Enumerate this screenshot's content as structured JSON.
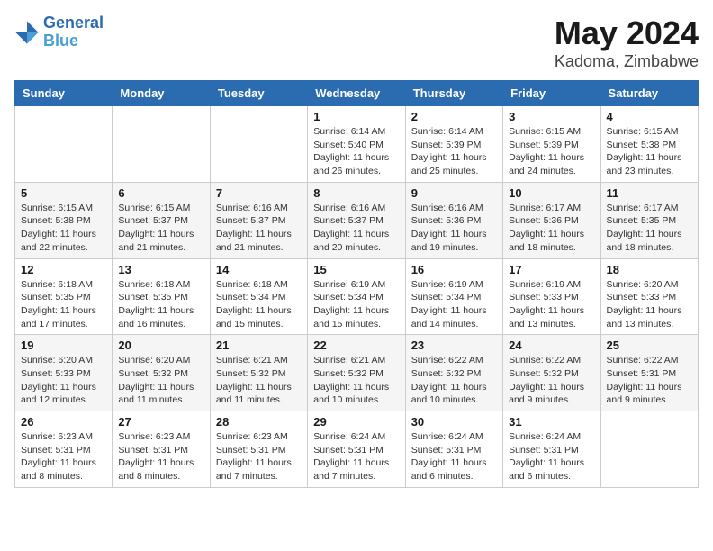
{
  "header": {
    "logo_general": "General",
    "logo_blue": "Blue",
    "month_title": "May 2024",
    "location": "Kadoma, Zimbabwe"
  },
  "weekdays": [
    "Sunday",
    "Monday",
    "Tuesday",
    "Wednesday",
    "Thursday",
    "Friday",
    "Saturday"
  ],
  "weeks": [
    [
      {
        "day": "",
        "info": ""
      },
      {
        "day": "",
        "info": ""
      },
      {
        "day": "",
        "info": ""
      },
      {
        "day": "1",
        "info": "Sunrise: 6:14 AM\nSunset: 5:40 PM\nDaylight: 11 hours\nand 26 minutes."
      },
      {
        "day": "2",
        "info": "Sunrise: 6:14 AM\nSunset: 5:39 PM\nDaylight: 11 hours\nand 25 minutes."
      },
      {
        "day": "3",
        "info": "Sunrise: 6:15 AM\nSunset: 5:39 PM\nDaylight: 11 hours\nand 24 minutes."
      },
      {
        "day": "4",
        "info": "Sunrise: 6:15 AM\nSunset: 5:38 PM\nDaylight: 11 hours\nand 23 minutes."
      }
    ],
    [
      {
        "day": "5",
        "info": "Sunrise: 6:15 AM\nSunset: 5:38 PM\nDaylight: 11 hours\nand 22 minutes."
      },
      {
        "day": "6",
        "info": "Sunrise: 6:15 AM\nSunset: 5:37 PM\nDaylight: 11 hours\nand 21 minutes."
      },
      {
        "day": "7",
        "info": "Sunrise: 6:16 AM\nSunset: 5:37 PM\nDaylight: 11 hours\nand 21 minutes."
      },
      {
        "day": "8",
        "info": "Sunrise: 6:16 AM\nSunset: 5:37 PM\nDaylight: 11 hours\nand 20 minutes."
      },
      {
        "day": "9",
        "info": "Sunrise: 6:16 AM\nSunset: 5:36 PM\nDaylight: 11 hours\nand 19 minutes."
      },
      {
        "day": "10",
        "info": "Sunrise: 6:17 AM\nSunset: 5:36 PM\nDaylight: 11 hours\nand 18 minutes."
      },
      {
        "day": "11",
        "info": "Sunrise: 6:17 AM\nSunset: 5:35 PM\nDaylight: 11 hours\nand 18 minutes."
      }
    ],
    [
      {
        "day": "12",
        "info": "Sunrise: 6:18 AM\nSunset: 5:35 PM\nDaylight: 11 hours\nand 17 minutes."
      },
      {
        "day": "13",
        "info": "Sunrise: 6:18 AM\nSunset: 5:35 PM\nDaylight: 11 hours\nand 16 minutes."
      },
      {
        "day": "14",
        "info": "Sunrise: 6:18 AM\nSunset: 5:34 PM\nDaylight: 11 hours\nand 15 minutes."
      },
      {
        "day": "15",
        "info": "Sunrise: 6:19 AM\nSunset: 5:34 PM\nDaylight: 11 hours\nand 15 minutes."
      },
      {
        "day": "16",
        "info": "Sunrise: 6:19 AM\nSunset: 5:34 PM\nDaylight: 11 hours\nand 14 minutes."
      },
      {
        "day": "17",
        "info": "Sunrise: 6:19 AM\nSunset: 5:33 PM\nDaylight: 11 hours\nand 13 minutes."
      },
      {
        "day": "18",
        "info": "Sunrise: 6:20 AM\nSunset: 5:33 PM\nDaylight: 11 hours\nand 13 minutes."
      }
    ],
    [
      {
        "day": "19",
        "info": "Sunrise: 6:20 AM\nSunset: 5:33 PM\nDaylight: 11 hours\nand 12 minutes."
      },
      {
        "day": "20",
        "info": "Sunrise: 6:20 AM\nSunset: 5:32 PM\nDaylight: 11 hours\nand 11 minutes."
      },
      {
        "day": "21",
        "info": "Sunrise: 6:21 AM\nSunset: 5:32 PM\nDaylight: 11 hours\nand 11 minutes."
      },
      {
        "day": "22",
        "info": "Sunrise: 6:21 AM\nSunset: 5:32 PM\nDaylight: 11 hours\nand 10 minutes."
      },
      {
        "day": "23",
        "info": "Sunrise: 6:22 AM\nSunset: 5:32 PM\nDaylight: 11 hours\nand 10 minutes."
      },
      {
        "day": "24",
        "info": "Sunrise: 6:22 AM\nSunset: 5:32 PM\nDaylight: 11 hours\nand 9 minutes."
      },
      {
        "day": "25",
        "info": "Sunrise: 6:22 AM\nSunset: 5:31 PM\nDaylight: 11 hours\nand 9 minutes."
      }
    ],
    [
      {
        "day": "26",
        "info": "Sunrise: 6:23 AM\nSunset: 5:31 PM\nDaylight: 11 hours\nand 8 minutes."
      },
      {
        "day": "27",
        "info": "Sunrise: 6:23 AM\nSunset: 5:31 PM\nDaylight: 11 hours\nand 8 minutes."
      },
      {
        "day": "28",
        "info": "Sunrise: 6:23 AM\nSunset: 5:31 PM\nDaylight: 11 hours\nand 7 minutes."
      },
      {
        "day": "29",
        "info": "Sunrise: 6:24 AM\nSunset: 5:31 PM\nDaylight: 11 hours\nand 7 minutes."
      },
      {
        "day": "30",
        "info": "Sunrise: 6:24 AM\nSunset: 5:31 PM\nDaylight: 11 hours\nand 6 minutes."
      },
      {
        "day": "31",
        "info": "Sunrise: 6:24 AM\nSunset: 5:31 PM\nDaylight: 11 hours\nand 6 minutes."
      },
      {
        "day": "",
        "info": ""
      }
    ]
  ]
}
